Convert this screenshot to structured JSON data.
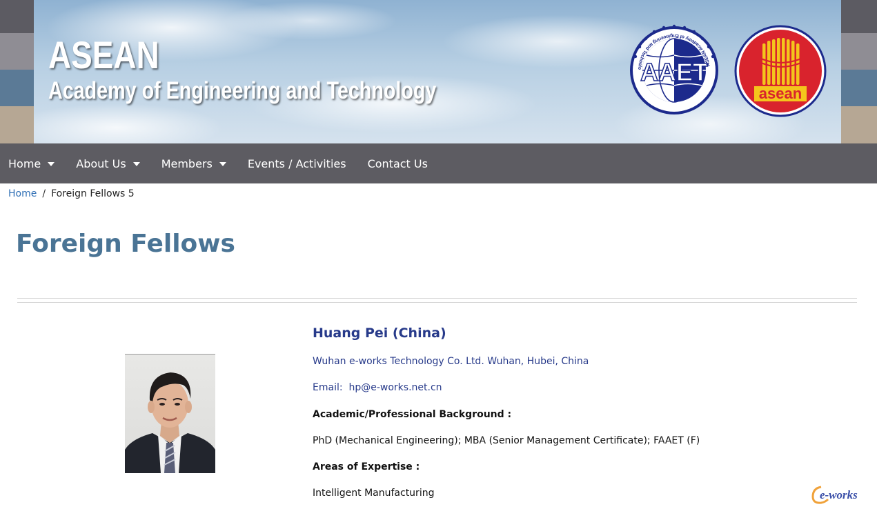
{
  "header": {
    "title_line1": "ASEAN",
    "title_line2": "Academy of Engineering and Technology",
    "aaet_logo_text": "AAET",
    "aaet_ring_text": "ASEAN Academy of Engineering and Technology",
    "asean_logo_text": "asean",
    "colors": {
      "aaet_blue": "#1c2a8c",
      "asean_red": "#d9232d",
      "asean_yellow": "#f4c51c"
    }
  },
  "nav": {
    "items": [
      {
        "label": "Home",
        "has_dropdown": true
      },
      {
        "label": "About Us",
        "has_dropdown": true
      },
      {
        "label": "Members",
        "has_dropdown": true
      },
      {
        "label": "Events / Activities",
        "has_dropdown": false
      },
      {
        "label": "Contact Us",
        "has_dropdown": false
      }
    ]
  },
  "breadcrumb": {
    "home": "Home",
    "separator": "/",
    "current": "Foreign Fellows 5"
  },
  "page": {
    "title": "Foreign Fellows"
  },
  "profile": {
    "name": "Huang Pei (China)",
    "affiliation": "Wuhan e-works Technology Co. Ltd. Wuhan, Hubei, China",
    "email_label": "Email:",
    "email": "hp@e-works.net.cn",
    "background_heading": "Academic/Professional Background :",
    "background": "PhD (Mechanical Engineering); MBA (Senior Management Certificate); FAAET (F)",
    "expertise_heading": "Areas of Expertise :",
    "expertise": "Intelligent Manufacturing"
  },
  "watermark": {
    "text": "e-works"
  }
}
